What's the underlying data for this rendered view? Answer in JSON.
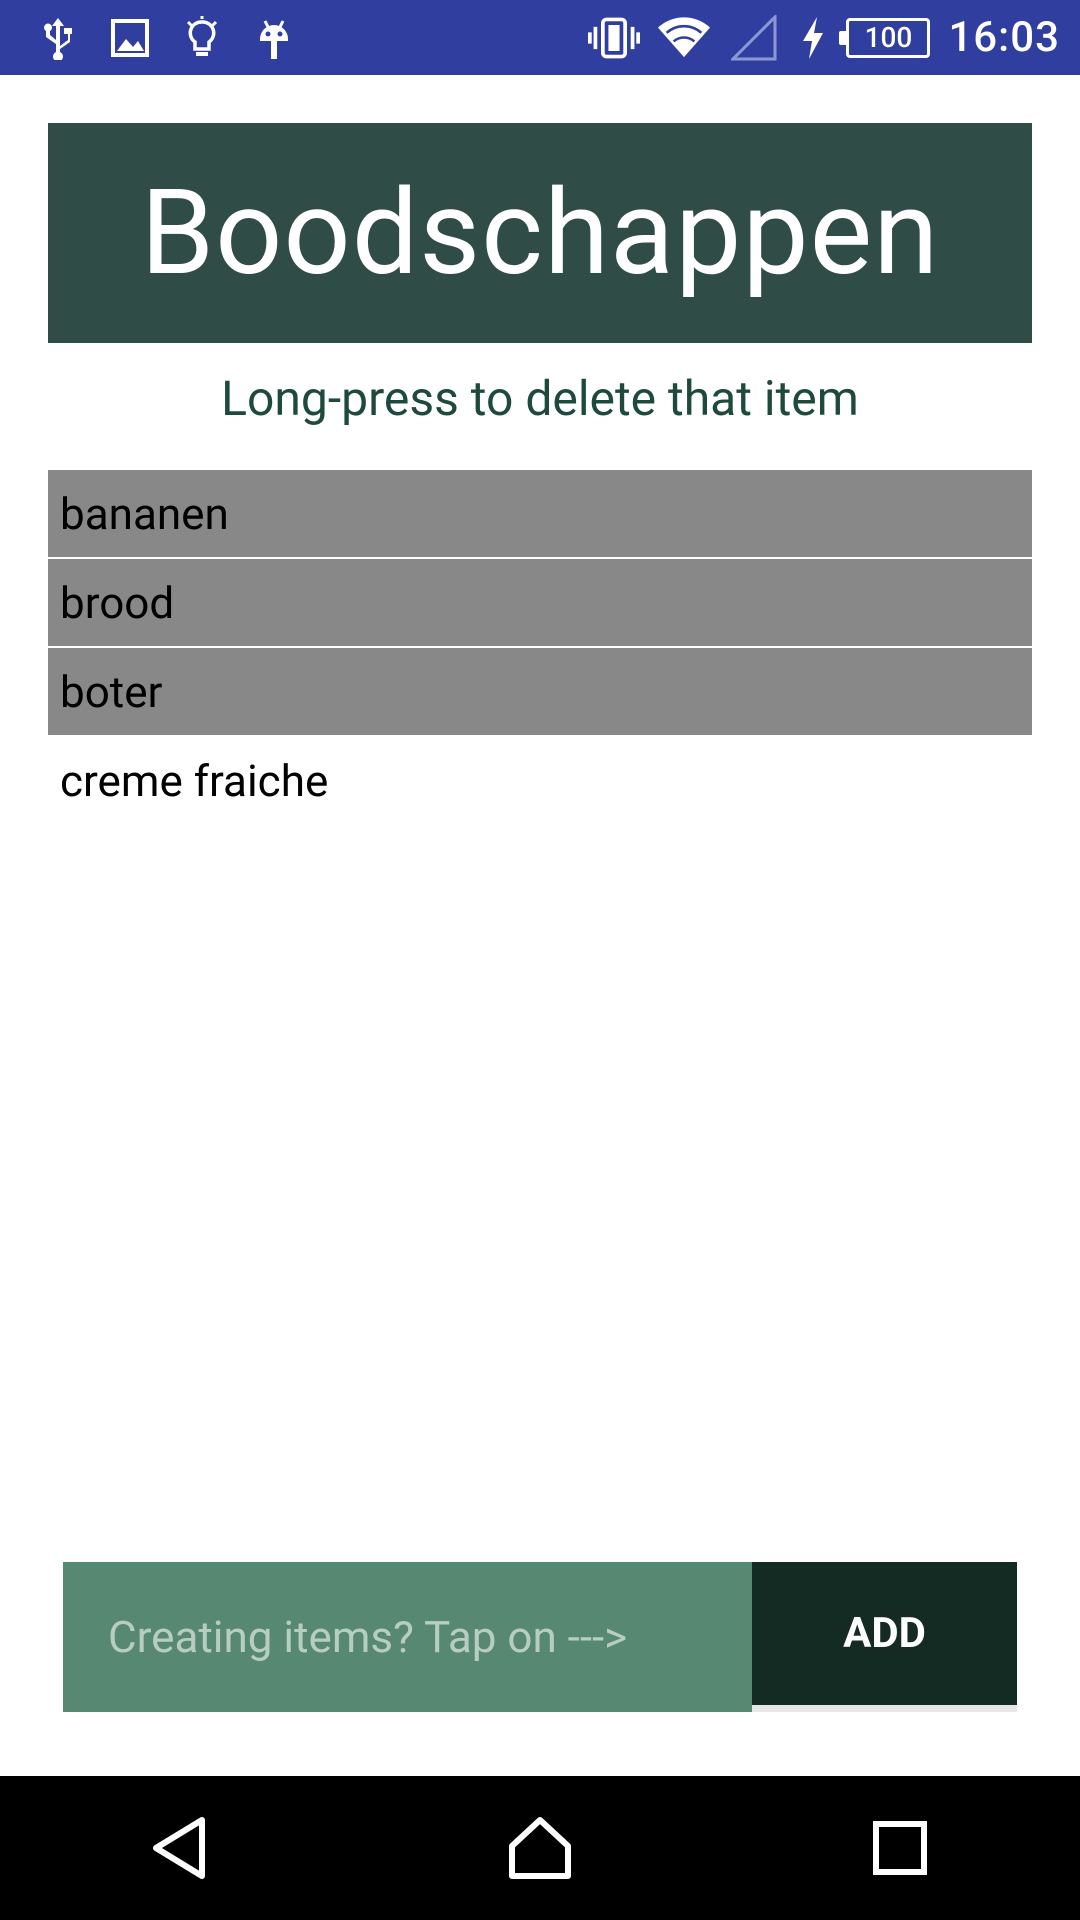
{
  "status_bar": {
    "battery_level": "100",
    "time": "16:03",
    "left_icons": [
      "usb-icon",
      "image-icon",
      "lightbulb-icon",
      "android-debug-icon"
    ],
    "right_icons": [
      "vibrate-icon",
      "wifi-icon",
      "signal-icon",
      "charging-icon"
    ]
  },
  "header": {
    "title": "Boodschappen"
  },
  "hint": "Long-press to delete that item",
  "list": {
    "items": [
      {
        "label": "bananen",
        "selected": true
      },
      {
        "label": "brood",
        "selected": true
      },
      {
        "label": "boter",
        "selected": true
      },
      {
        "label": "creme fraiche",
        "selected": false
      }
    ]
  },
  "input": {
    "placeholder": "Creating items? Tap on --->",
    "value": ""
  },
  "add_button": {
    "label": "ADD"
  },
  "nav_bar": {
    "buttons": [
      "back-icon",
      "home-icon",
      "recents-icon"
    ]
  },
  "colors": {
    "status_bar": "#303F9F",
    "header_bg": "#304C46",
    "hint_text": "#1E4A3E",
    "selected_item": "#888888",
    "input_bg": "#578871",
    "add_button_bg": "#132B23"
  }
}
